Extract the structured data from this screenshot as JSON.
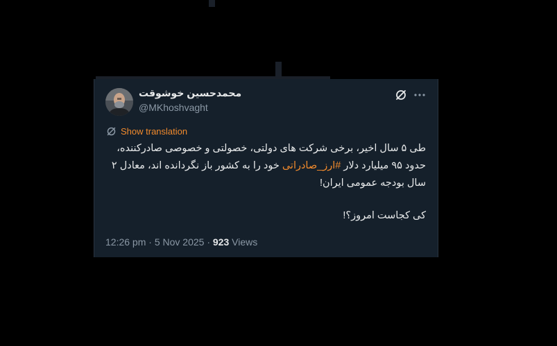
{
  "author": {
    "display_name": "محمدحسین خوشوقت",
    "handle": "@MKhoshvaght"
  },
  "tweet": {
    "translate_label": "Show translation",
    "text_part1": "طی ۵ سال اخیر، برخی شرکت های دولتی، خصولتی و خصوصی صادرکننده، حدود ۹۵ میلیارد دلار ",
    "hashtag": "#ارز_صادراتی",
    "text_part2": " خود را به کشور باز نگردانده اند، معادل ۲ سال بودجه عمومی ایران!",
    "question": "کی کجاست امروز؟!"
  },
  "meta": {
    "time": "12:26 pm",
    "sep1": " · ",
    "date": "5 Nov 2025",
    "sep2": " · ",
    "views_count": "923",
    "views_label": " Views"
  },
  "colors": {
    "background": "#000000",
    "card": "#15202b",
    "accent": "#f18a2c",
    "text": "#e7e9ea",
    "muted": "#8b98a5"
  },
  "icons": {
    "top_right": [
      "grok-icon",
      "more-icon"
    ],
    "translate": "translate-icon"
  }
}
